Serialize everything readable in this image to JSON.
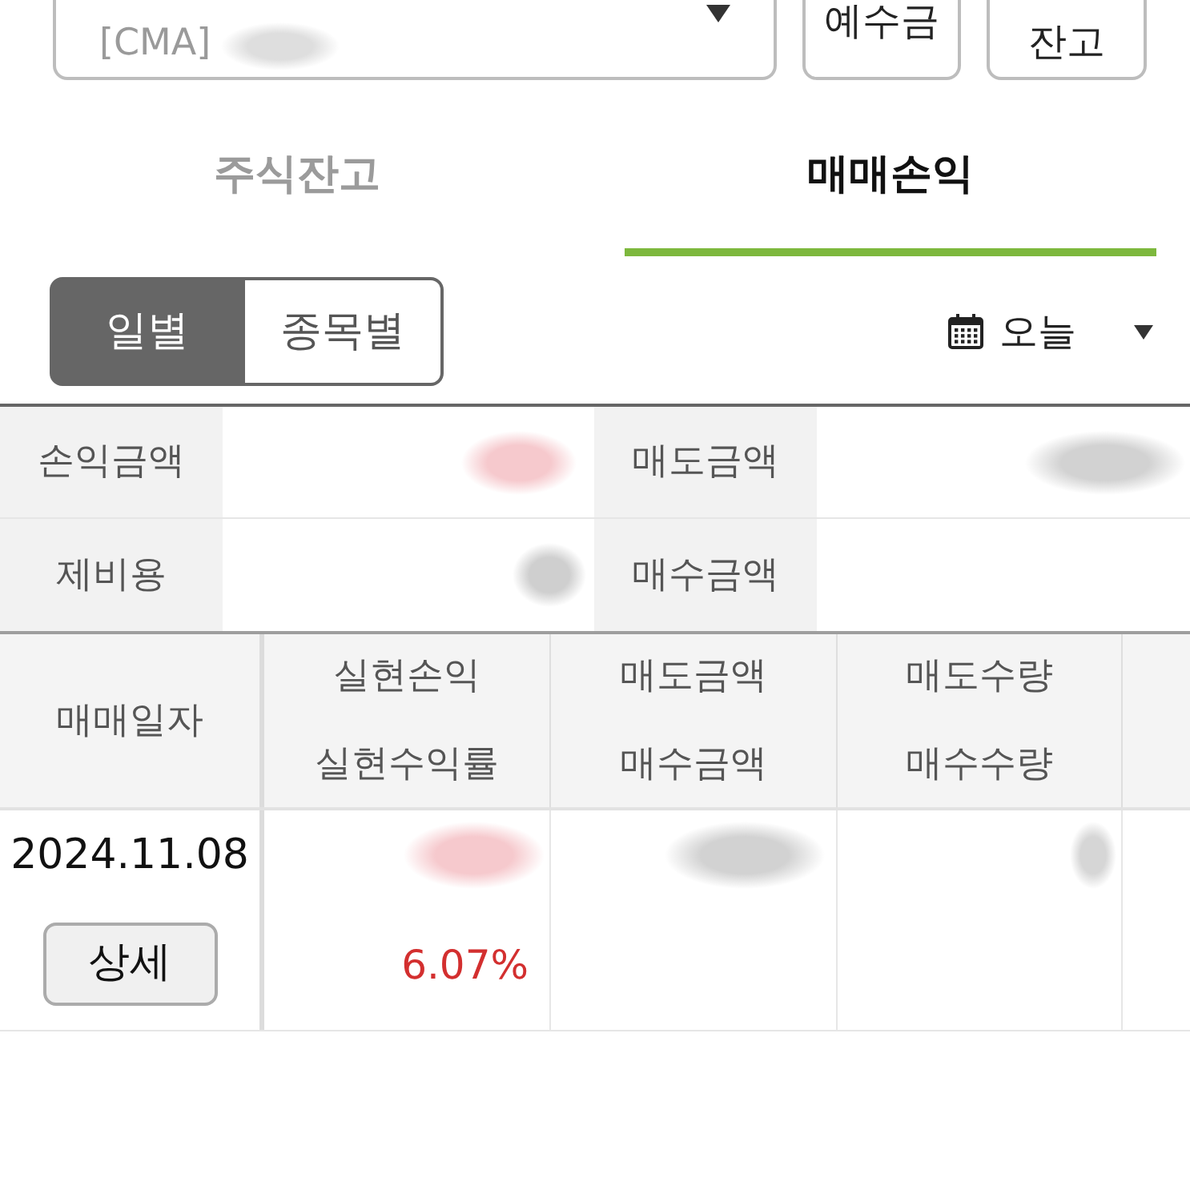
{
  "account_selector": {
    "account_type": "[CMA]",
    "account_name": {
      "kind": "blurred",
      "color": "#dedede"
    }
  },
  "header_buttons": [
    "예수금",
    "잔고"
  ],
  "tabs": [
    {
      "label": "주식잔고",
      "selected": false
    },
    {
      "label": "매매손익",
      "selected": true
    }
  ],
  "view_toggle": [
    {
      "label": "일별",
      "selected": true
    },
    {
      "label": "종목별",
      "selected": false
    }
  ],
  "date_filter": {
    "label": "오늘"
  },
  "summary": [
    {
      "label": "손익금액",
      "value": {
        "kind": "blurred",
        "color": "#f6c9cd"
      }
    },
    {
      "label": "매도금액",
      "value": {
        "kind": "blurred",
        "color": "#d2d2d2"
      }
    },
    {
      "label": "제비용",
      "value": {
        "kind": "blurred",
        "color": "#cfcfcf"
      }
    },
    {
      "label": "매수금액"
    }
  ],
  "table": {
    "columns": [
      {
        "lines": [
          "매매일자"
        ]
      },
      {
        "lines": [
          "실현손익",
          "실현수익률"
        ]
      },
      {
        "lines": [
          "매도금액",
          "매수금액"
        ]
      },
      {
        "lines": [
          "매도수량",
          "매수수량"
        ]
      }
    ],
    "rows": [
      {
        "cells": [
          {
            "top": {
              "kind": "text",
              "text": "2024.11.08"
            },
            "bottom": {
              "kind": "button",
              "text": "상세"
            }
          },
          {
            "top": {
              "kind": "blurred",
              "color": "#f6c9cd"
            },
            "bottom": {
              "kind": "text",
              "text": "6.07%",
              "color": "#d32f2f"
            }
          },
          {
            "top": {
              "kind": "blurred",
              "color": "#d2d2d2"
            }
          },
          {
            "top": {
              "kind": "blurred",
              "color": "#d6d6d6"
            }
          }
        ]
      }
    ]
  }
}
